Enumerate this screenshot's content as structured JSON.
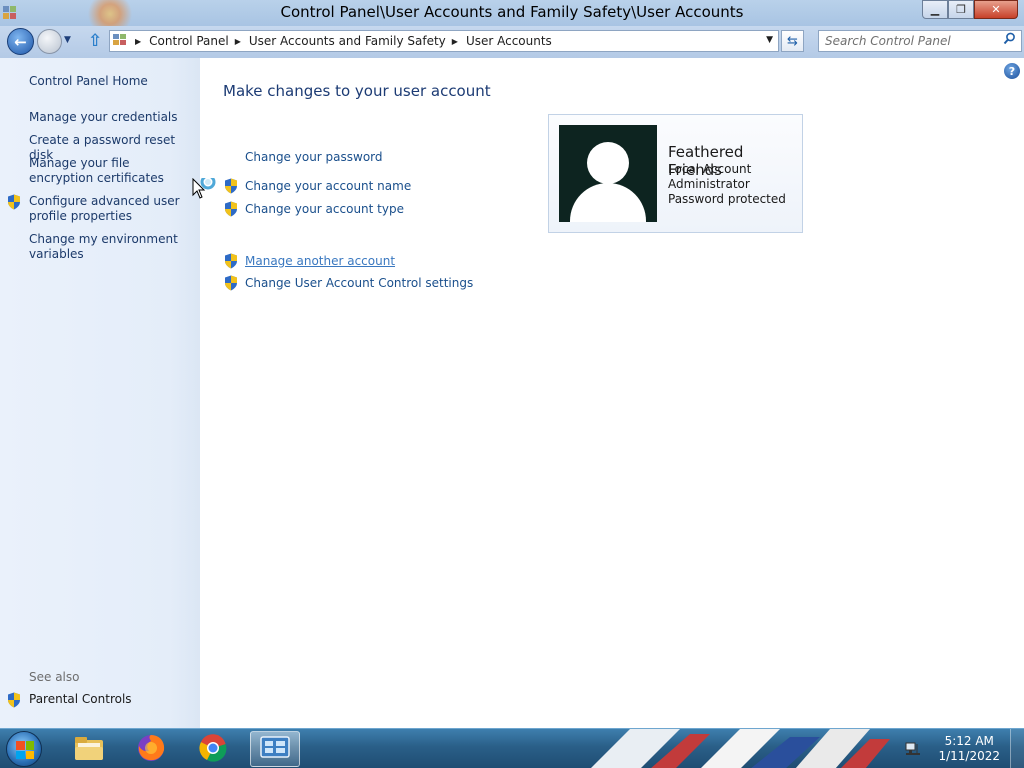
{
  "window": {
    "title": "Control Panel\\User Accounts and Family Safety\\User Accounts",
    "buttons": {
      "minimize": "▁",
      "maximize": "❐",
      "close": "✕"
    }
  },
  "address_bar": {
    "breadcrumbs": [
      "Control Panel",
      "User Accounts and Family Safety",
      "User Accounts"
    ],
    "search_placeholder": "Search Control Panel"
  },
  "left_pane": {
    "home": "Control Panel Home",
    "links": [
      {
        "label": "Manage your credentials",
        "shield": false
      },
      {
        "label": "Create a password reset disk",
        "shield": false
      },
      {
        "label": "Manage your file encryption certificates",
        "shield": false
      },
      {
        "label": "Configure advanced user profile properties",
        "shield": true
      },
      {
        "label": "Change my environment variables",
        "shield": false
      }
    ],
    "see_also_label": "See also",
    "see_also": [
      {
        "label": "Parental Controls",
        "shield": true
      }
    ]
  },
  "main": {
    "heading": "Make changes to your user account",
    "tasks": [
      {
        "label": "Change your password",
        "shield": false
      },
      {
        "label": "Change your account name",
        "shield": true
      },
      {
        "label": "Change your account type",
        "shield": true
      }
    ],
    "tasks2": [
      {
        "label": "Manage another account",
        "shield": true,
        "hover": true
      },
      {
        "label": "Change User Account Control settings",
        "shield": true
      }
    ],
    "user": {
      "name": "Feathered Friends",
      "lines": [
        "Local Account",
        "Administrator",
        "Password protected"
      ]
    }
  },
  "taskbar": {
    "apps": [
      "file-explorer",
      "firefox",
      "chrome",
      "control-panel"
    ],
    "active_app": "control-panel",
    "time": "5:12 AM",
    "date": "1/11/2022"
  },
  "colors": {
    "link": "#1a4f8c",
    "heading": "#1c3b74",
    "taskbar": "#2a5f88"
  }
}
